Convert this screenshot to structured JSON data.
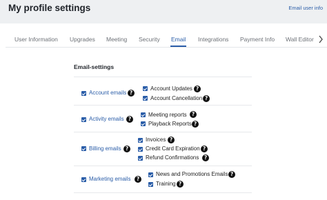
{
  "header": {
    "title": "My profile settings",
    "email_user_info_link": "Email user info"
  },
  "tabs": [
    {
      "label": "User Information",
      "active": false
    },
    {
      "label": "Upgrades",
      "active": false
    },
    {
      "label": "Meeting",
      "active": false
    },
    {
      "label": "Security",
      "active": false
    },
    {
      "label": "Email",
      "active": true
    },
    {
      "label": "Integrations",
      "active": false
    },
    {
      "label": "Payment Info",
      "active": false
    },
    {
      "label": "Wall Editor",
      "active": false
    }
  ],
  "email_settings": {
    "title": "Email-settings",
    "help_glyph": "?",
    "groups": [
      {
        "label": "Account emails",
        "checked": true,
        "items": [
          {
            "label": "Account Updates",
            "checked": true
          },
          {
            "label": "Account Cancellation",
            "checked": true
          }
        ]
      },
      {
        "label": "Activity emails",
        "checked": true,
        "items": [
          {
            "label": "Meeting reports",
            "checked": true
          },
          {
            "label": "Playback Reports",
            "checked": true
          }
        ]
      },
      {
        "label": "Billing emails",
        "checked": true,
        "items": [
          {
            "label": "Invoices",
            "checked": true
          },
          {
            "label": "Credit Card Expiration",
            "checked": true
          },
          {
            "label": "Refund Confirmations",
            "checked": true
          }
        ]
      },
      {
        "label": "Marketing emails",
        "checked": true,
        "items": [
          {
            "label": "News and Promotions Emails",
            "checked": true
          },
          {
            "label": "Training",
            "checked": true
          }
        ]
      }
    ]
  },
  "colors": {
    "accent": "#2a5da8",
    "header_bg": "#eef0f2",
    "help_icon": "#111111"
  },
  "icons": {
    "checkbox": "checkbox-checked-icon",
    "help": "help-icon",
    "tabs_scroll": "chevron-right-icon"
  }
}
